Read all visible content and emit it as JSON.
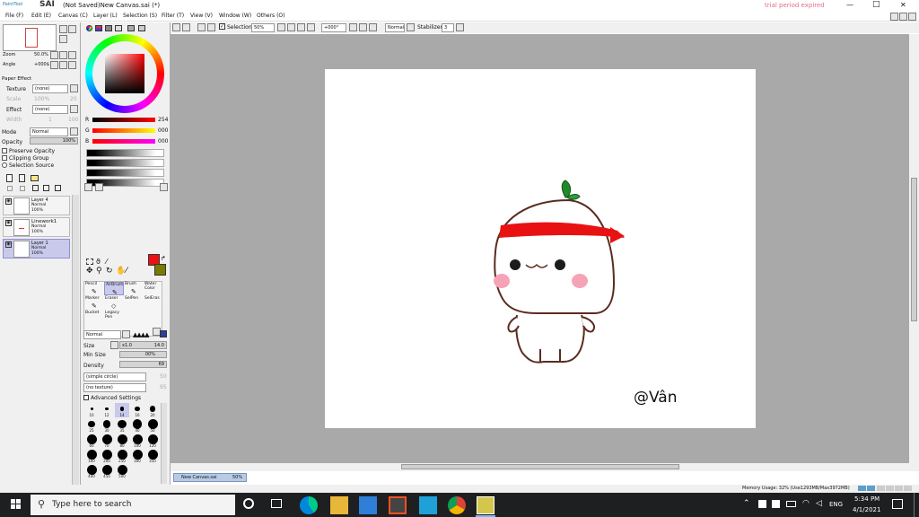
{
  "app": {
    "logo_text": "PaintTool",
    "logo_name": "SAI",
    "window_title": "(Not Saved)New Canvas.sai (*)",
    "trial_text": "trial period expired"
  },
  "window_controls": {
    "minimize": "—",
    "maximize": "□",
    "close": "✕"
  },
  "menu": [
    "File (F)",
    "Edit (E)",
    "Canvas (C)",
    "Layer (L)",
    "Selection (S)",
    "Filter (T)",
    "View (V)",
    "Window (W)",
    "Others (O)"
  ],
  "toolbar": {
    "selection_label": "Selection",
    "zoom_value": "50%",
    "angle_value": "+000°",
    "blend_value": "Normal",
    "stabilizer_label": "Stabilizer",
    "stabilizer_value": "3"
  },
  "navigator": {
    "zoom_label": "Zoom",
    "zoom_value": "50.0%",
    "angle_label": "Angle",
    "angle_value": "+000$"
  },
  "paper_effect": {
    "title": "Paper Effect",
    "texture_label": "Texture",
    "texture_value": "(none)",
    "scale_label": "Scale",
    "scale_value": "100%",
    "scale_num": "20",
    "effect_label": "Effect",
    "effect_value": "(none)",
    "width_label": "Width",
    "width_num": "1",
    "width_max": "100"
  },
  "layer_props": {
    "mode_label": "Mode",
    "mode_value": "Normal",
    "opacity_label": "Opacity",
    "opacity_value": "100%",
    "preserve_opacity": "Preserve Opacity",
    "clipping_group": "Clipping Group",
    "selection_source": "Selection Source"
  },
  "layers": [
    {
      "name": "Layer 4",
      "mode": "Normal",
      "opacity": "100%",
      "active": false
    },
    {
      "name": "Linework1",
      "mode": "Normal",
      "opacity": "100%",
      "active": false
    },
    {
      "name": "Layer 1",
      "mode": "Normal",
      "opacity": "100%",
      "active": true
    }
  ],
  "color": {
    "r_label": "R",
    "r_value": "254",
    "g_label": "G",
    "g_value": "000",
    "b_label": "B",
    "b_value": "000",
    "primary": "#ee1111",
    "secondary": "#7a7a00"
  },
  "tools": [
    {
      "label": "Pencil"
    },
    {
      "label": "AirBrush"
    },
    {
      "label": "Brush"
    },
    {
      "label": "Water Color"
    },
    {
      "label": "Marker"
    },
    {
      "label": "Eraser"
    },
    {
      "label": "SelPen"
    },
    {
      "label": "SelEras"
    },
    {
      "label": "Bucket"
    },
    {
      "label": "Legacy Pen"
    }
  ],
  "brush_settings": {
    "blend_value": "Normal",
    "size_label": "Size",
    "size_mult": "x1.0",
    "size_value": "14.0",
    "min_size_label": "Min Size",
    "min_size_value": "00%",
    "density_label": "Density",
    "density_value": "69",
    "shape_value": "(simple circle)",
    "shape_num": "50",
    "texture_value": "(no texture)",
    "texture_num": "95",
    "advanced_label": "Advanced Settings"
  },
  "brush_sizes": [
    "10",
    "12",
    "14",
    "16",
    "20",
    "25",
    "30",
    "35",
    "40",
    "50",
    "60",
    "70",
    "80",
    "100",
    "120",
    "160",
    "200",
    "250",
    "300",
    "350",
    "400",
    "450",
    "500"
  ],
  "canvas": {
    "signature": "@Vân",
    "bg": "#ffffff"
  },
  "status": {
    "tab_name": "New Canvas.sai",
    "tab_zoom": "50%",
    "memory": "Memory Usage: 32% (Use1293MB/Max3972MB)"
  },
  "taskbar": {
    "search_placeholder": "Type here to search",
    "language": "ENG",
    "time": "5:34 PM",
    "date": "4/1/2021"
  }
}
